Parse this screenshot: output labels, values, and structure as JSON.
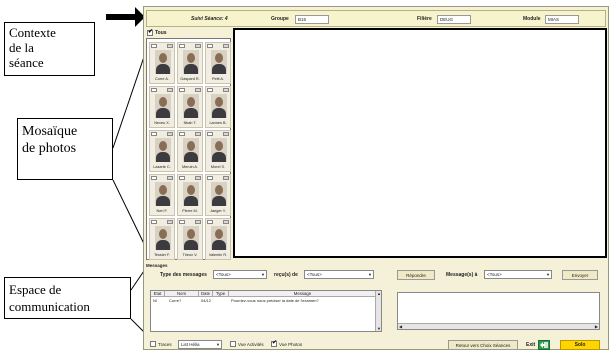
{
  "annotations": {
    "contexte": [
      "Contexte",
      "de la",
      "séance"
    ],
    "mosaique": [
      "Mosaïque",
      "de photos"
    ],
    "espace": [
      "Espace de",
      "communication"
    ]
  },
  "context_bar": {
    "seance_label": "Suivi Séance: 4",
    "groupe_label": "Groupe",
    "groupe_value": "B15",
    "filiere_label": "Filière",
    "filiere_value": "DEUG",
    "module_label": "Module",
    "module_value": "MIAS"
  },
  "tous_label": "Tous",
  "photos": [
    {
      "name": "Corre A."
    },
    {
      "name": "Gaspard R."
    },
    {
      "name": "Petit A."
    },
    {
      "name": "Neveu X."
    },
    {
      "name": "Nkab T."
    },
    {
      "name": "Lannes B."
    },
    {
      "name": "Lazarte C."
    },
    {
      "name": "Meruin A."
    },
    {
      "name": "Morel S."
    },
    {
      "name": "Nerl F."
    },
    {
      "name": "Pierre M."
    },
    {
      "name": "Jaeger Y."
    },
    {
      "name": "Tessier F."
    },
    {
      "name": "Trieux V."
    },
    {
      "name": "Valentin R."
    }
  ],
  "communication": {
    "title": "Messages",
    "type_label": "Type des messages",
    "type_value": "<Tous>",
    "recus_label": "reçu(s) de",
    "recus_value": "<Tous>",
    "repondre_label": "Répondre",
    "messages_a_label": "Message(s) à",
    "messages_a_value": "<Tous>",
    "envoyer_label": "Envoyer",
    "columns": [
      "Etat",
      "Nom",
      "Date",
      "Type",
      "Message"
    ],
    "rows": [
      {
        "etat": "Nl",
        "nom": "Corre?",
        "date": "04/12",
        "type": "",
        "message": "Pourriez-vous nous préciser la date de l'examen?"
      }
    ]
  },
  "bottom_bar": {
    "traces_label": "Traces",
    "list_value": "List Hélia",
    "vue_activites_label": "Vue Activités",
    "vue_photos_label": "Vue Photos",
    "retour_label": "Retour vers Choix Séances",
    "exit_label": "Exit",
    "solo_label": "Solo"
  },
  "colors": {
    "window_bg": "#f4f1d8",
    "context_bg": "#f7f3cc",
    "solo_button": "#ffd400",
    "exit_icon": "#2e9b4e"
  }
}
